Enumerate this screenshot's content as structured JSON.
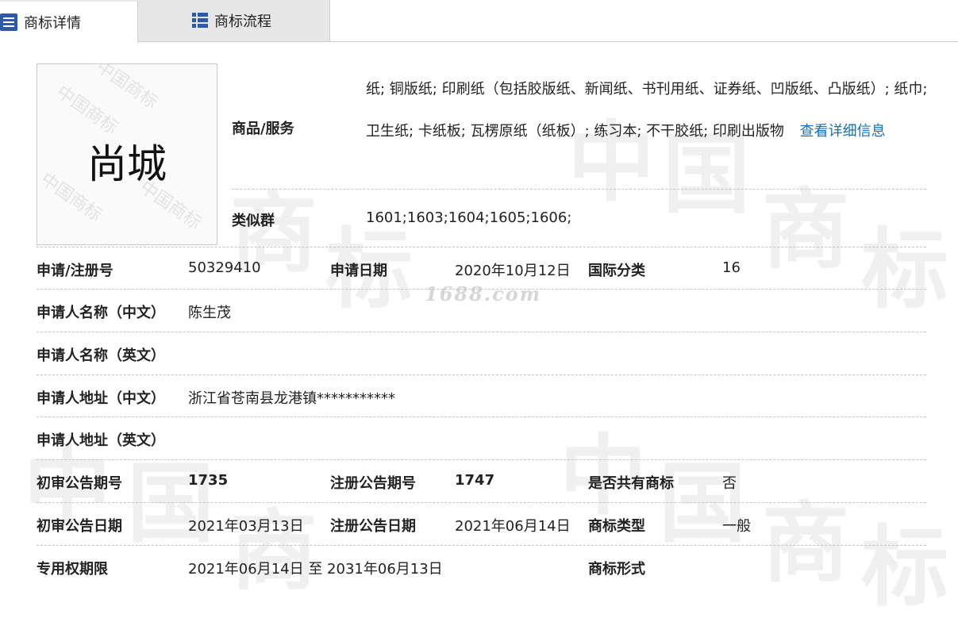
{
  "tabs": [
    {
      "label": "商标详情",
      "icon": "list-icon",
      "active": true
    },
    {
      "label": "商标流程",
      "icon": "flow-icon",
      "active": false
    }
  ],
  "trademark_image": {
    "text": "尚城",
    "watermark_text": "中国商标"
  },
  "watermark": {
    "site": "1688.com",
    "big_chars": [
      "中",
      "国",
      "商",
      "标"
    ]
  },
  "goods": {
    "label": "商品/服务",
    "text": "纸; 铜版纸; 印刷纸（包括胶版纸、新闻纸、书刊用纸、证券纸、凹版纸、凸版纸）; 纸巾; 卫生纸; 卡纸板; 瓦楞原纸（纸板）; 练习本; 不干胶纸; 印刷出版物",
    "more_link": "查看详细信息"
  },
  "similar_group": {
    "label": "类似群",
    "value": "1601;1603;1604;1605;1606;"
  },
  "fields": {
    "reg_no_label": "申请/注册号",
    "reg_no": "50329410",
    "apply_date_label": "申请日期",
    "apply_date": "2020年10月12日",
    "intl_class_label": "国际分类",
    "intl_class": "16",
    "applicant_cn_label": "申请人名称（中文）",
    "applicant_cn": "陈生茂",
    "applicant_en_label": "申请人名称（英文）",
    "applicant_en": "",
    "address_cn_label": "申请人地址（中文）",
    "address_cn": "浙江省苍南县龙港镇***********",
    "address_en_label": "申请人地址（英文）",
    "address_en": "",
    "prelim_no_label": "初审公告期号",
    "prelim_no": "1735",
    "reg_notice_no_label": "注册公告期号",
    "reg_notice_no": "1747",
    "shared_label": "是否共有商标",
    "shared": "否",
    "prelim_date_label": "初审公告日期",
    "prelim_date": "2021年03月13日",
    "reg_notice_date_label": "注册公告日期",
    "reg_notice_date": "2021年06月14日",
    "tm_type_label": "商标类型",
    "tm_type": "一般",
    "exclusive_label": "专用权期限",
    "exclusive": "2021年06月14日 至 2031年06月13日",
    "tm_form_label": "商标形式",
    "tm_form": ""
  }
}
